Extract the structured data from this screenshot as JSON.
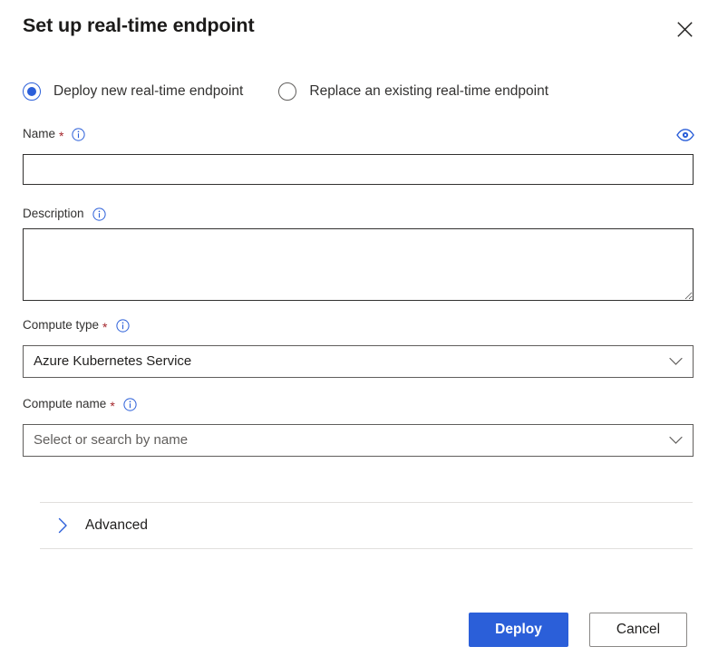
{
  "dialog": {
    "title": "Set up real-time endpoint",
    "close_icon": "close-icon"
  },
  "mode": {
    "options": [
      {
        "label": "Deploy new real-time endpoint",
        "selected": true
      },
      {
        "label": "Replace an existing real-time endpoint",
        "selected": false
      }
    ]
  },
  "fields": {
    "name": {
      "label": "Name",
      "required_marker": "*",
      "info_icon": "info-icon",
      "value": "",
      "placeholder": "",
      "reveal_icon": "eye-icon"
    },
    "description": {
      "label": "Description",
      "info_icon": "info-icon",
      "value": "",
      "placeholder": ""
    },
    "compute_type": {
      "label": "Compute type",
      "required_marker": "*",
      "info_icon": "info-icon",
      "value": "Azure Kubernetes Service",
      "chevron_icon": "chevron-down-icon"
    },
    "compute_name": {
      "label": "Compute name",
      "required_marker": "*",
      "info_icon": "info-icon",
      "value": "",
      "placeholder": "Select or search by name",
      "chevron_icon": "chevron-down-icon"
    }
  },
  "advanced": {
    "label": "Advanced",
    "chevron_icon": "chevron-right-icon",
    "expanded": false
  },
  "footer": {
    "primary_label": "Deploy",
    "secondary_label": "Cancel"
  },
  "colors": {
    "accent": "#2b5fd9",
    "required": "#a4262c",
    "text": "#201f1e",
    "border": "#323130",
    "divider": "#e1dfdd"
  }
}
